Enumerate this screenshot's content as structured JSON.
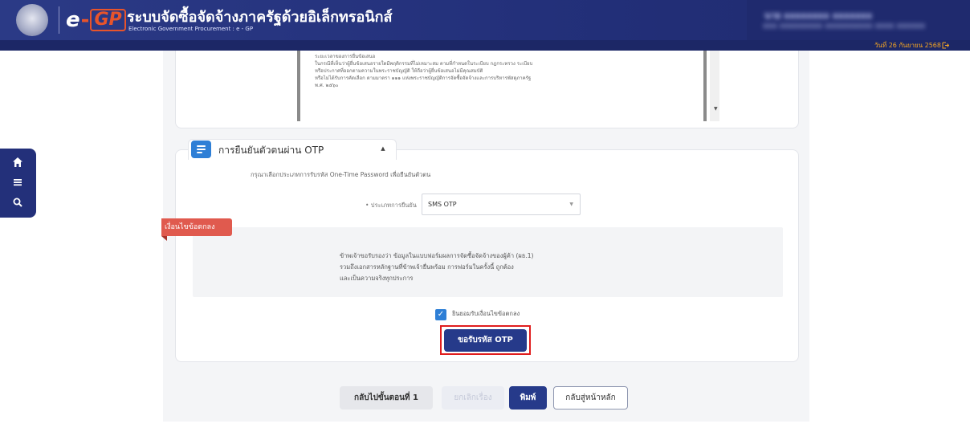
{
  "header": {
    "logo_e": "e",
    "logo_dash": "-",
    "logo_gp": "GP",
    "title": "ระบบจัดซื้อจัดจ้างภาครัฐด้วยอิเล็กทรอนิกส์",
    "subtitle": "Electronic Government Procurement : e - GP",
    "user_name": "นาย xxxxxxxx xxxxxxx",
    "user_org": "xxx xxxxxxxxx xxxxxxxxxx xxxx xxxxxx",
    "date": "วันที่ 26 กันยายน 2568",
    "logout_icon": "logout-icon"
  },
  "sidenav": {
    "items": [
      {
        "icon": "home-icon",
        "glyph": "⌂"
      },
      {
        "icon": "menu-icon",
        "glyph": "≡"
      },
      {
        "icon": "search-icon",
        "glyph": "⚲"
      }
    ]
  },
  "document": {
    "lines": [
      "ระยะเวลาของการยื่นข้อเสนอ",
      "ในกรณีที่เห็นว่าผู้ยื่นข้อเสนอรายใดมีพฤติกรรมที่ไม่เหมาะสม ตามที่กำหนดในระเบียบ กฎกระทรวง ระเบียบ",
      "หรือประกาศที่ออกตามความในพระราชบัญญัติ ให้ถือว่าผู้ยื่นข้อเสนอไม่มีคุณสมบัติ",
      "หรือไม่ได้รับการคัดเลือก ตามมาตรา ๑๑๑ แห่งพระราชบัญญัติการจัดซื้อจัดจ้างและการบริหารพัสดุภาครัฐ",
      "พ.ศ. ๒๕๖๐"
    ]
  },
  "otp": {
    "section_title": "การยืนยันตัวตนผ่าน OTP",
    "collapse_glyph": "▲",
    "instruction": "กรุณาเลือกประเภทการรับรหัส One-Time Password เพื่อยืนยันตัวตน",
    "type_label": "• ประเภทการยืนยัน",
    "type_value": "SMS OTP",
    "type_caret": "▼",
    "ribbon": "เงื่อนไขข้อตกลง",
    "consent_lines": [
      "ข้าพเจ้าขอรับรองว่า ข้อมูลในแบบฟอร์มผลการจัดซื้อจัดจ้างของผู้ค้า (ผธ.1)",
      "รวมถึงเอกสารหลักฐานที่ข้าพเจ้ายื่นพร้อม การฟอร์มในครั้งนี้ ถูกต้อง",
      "และเป็นความจริงทุกประการ"
    ],
    "agree_check": "✓",
    "agree_label": "ยินยอมรับเงื่อนไขข้อตกลง",
    "request_button": "ขอรับรหัส OTP"
  },
  "footer": {
    "back_button": "กลับไปขั้นตอนที่ 1",
    "cancel_button": "ยกเลิกเรื่อง",
    "print_button": "พิมพ์",
    "home_button": "กลับสู่หน้าหลัก"
  }
}
